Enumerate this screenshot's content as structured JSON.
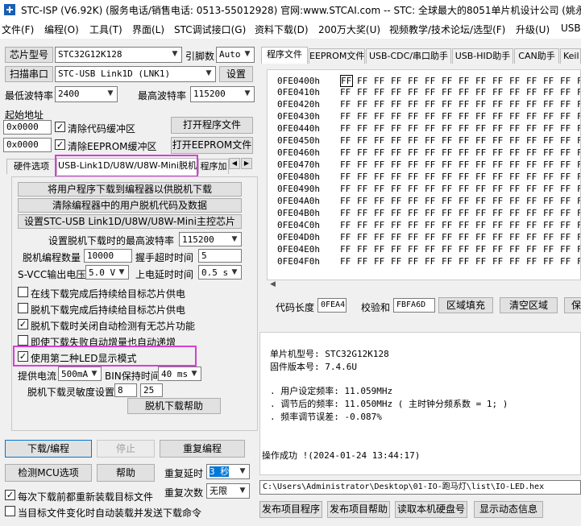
{
  "window": {
    "title": "STC-ISP (V6.92K) (服务电话/销售电话: 0513-55012928) 官网:www.STCAI.com  -- STC: 全球最大的8051单片机设计公司 (姚永平"
  },
  "menu": [
    "文件(F)",
    "编程(O)",
    "工具(T)",
    "界面(L)",
    "STC调试接口(G)",
    "资料下载(D)",
    "200万大奖(U)",
    "视频教学/技术论坛/选型(F)",
    "升级(U)",
    "USB"
  ],
  "left": {
    "chip_label": "芯片型号",
    "chip_value": "STC32G12K128",
    "pins_label": "引脚数",
    "pins_value": "Auto",
    "scan_port": "扫描串口",
    "port_value": "STC-USB Link1D (LNK1)",
    "settings": "设置",
    "min_baud_label": "最低波特率",
    "min_baud": "2400",
    "max_baud_label": "最高波特率",
    "max_baud": "115200",
    "start_addr_label": "起始地址",
    "addr1": "0x0000",
    "clear_code": "清除代码缓冲区",
    "open_prog": "打开程序文件",
    "addr2": "0x0000",
    "clear_eeprom": "清除EEPROM缓冲区",
    "open_eeprom": "打开EEPROM文件",
    "tabs": [
      "硬件选项",
      "USB-Link1D/U8W/U8W-Mini脱机",
      "程序加"
    ],
    "offline": {
      "btn1": "将用户程序下载到编程器以供脱机下载",
      "btn2": "清除编程器中的用户脱机代码及数据",
      "btn3": "设置STC-USB Link1D/U8W/U8W-Mini主控芯片",
      "max_baud_label": "设置脱机下载时的最高波特率",
      "max_baud": "115200",
      "prog_count_label": "脱机编程数量",
      "prog_count": "10000",
      "handshake_label": "握手超时时间",
      "handshake": "5",
      "svcc_label": "S-VCC输出电压",
      "svcc": "5.0 V",
      "power_delay_label": "上电延时时间",
      "power_delay": "0.5 s",
      "options": [
        {
          "label": "在线下载完成后持续给目标芯片供电",
          "checked": false
        },
        {
          "label": "脱机下载完成后持续给目标芯片供电",
          "checked": false
        },
        {
          "label": "脱机下载时关闭自动检测有无芯片功能",
          "checked": true
        },
        {
          "label": "即使下载失败自动增量也自动递增",
          "checked": false
        },
        {
          "label": "使用第二种LED显示模式",
          "checked": true
        }
      ],
      "supply_current_label": "提供电流",
      "supply_current": "500mA",
      "bin_hold_label": "BIN保持时间",
      "bin_hold": "40 ms",
      "sensitivity_label": "脱机下载灵敏度设置",
      "sens1": "8",
      "sens2": "25",
      "help": "脱机下载帮助"
    },
    "download": "下载/编程",
    "stop": "停止",
    "reprogram": "重复编程",
    "detect_mcu": "检测MCU选项",
    "help": "帮助",
    "repeat_delay_label": "重复延时",
    "repeat_delay": "3 秒",
    "repeat_count_label": "重复次数",
    "repeat_count": "无限",
    "reload_each": "每次下载前都重新装载目标文件",
    "auto_load": "当目标文件变化时自动装载并发送下载命令"
  },
  "right": {
    "tabs": [
      "程序文件",
      "EEPROM文件",
      "USB-CDC/串口助手",
      "USB-HID助手",
      "CAN助手",
      "Keil"
    ],
    "hex_rows": [
      "0FE0400h",
      "0FE0410h",
      "0FE0420h",
      "0FE0430h",
      "0FE0440h",
      "0FE0450h",
      "0FE0460h",
      "0FE0470h",
      "0FE0480h",
      "0FE0490h",
      "0FE04A0h",
      "0FE04B0h",
      "0FE04C0h",
      "0FE04D0h",
      "0FE04E0h",
      "0FE04F0h"
    ],
    "hex_byte": "FF",
    "code_len_label": "代码长度",
    "code_len": "0FEA4",
    "checksum_label": "校验和",
    "checksum": "FBFA6D",
    "fill_region": "区域填充",
    "clear_region": "清空区域",
    "save": "保",
    "info": {
      "l1": "单片机型号: STC32G12K128",
      "l2": "固件版本号: 7.4.6U",
      "l3": ". 用户设定频率: 11.059MHz",
      "l4": ". 调节后的频率: 11.050MHz ( 主时钟分频系数 = 1; )",
      "l5": ". 频率调节误差: -0.087%",
      "l6": "操作成功 !(2024-01-24 13:44:17)"
    },
    "path": "C:\\Users\\Administrator\\Desktop\\01-IO-跑马灯\\list\\IO-LED.hex",
    "publish_prog": "发布项目程序",
    "publish_help": "发布项目帮助",
    "read_disk": "读取本机硬盘号",
    "show_dynamic": "显示动态信息"
  }
}
